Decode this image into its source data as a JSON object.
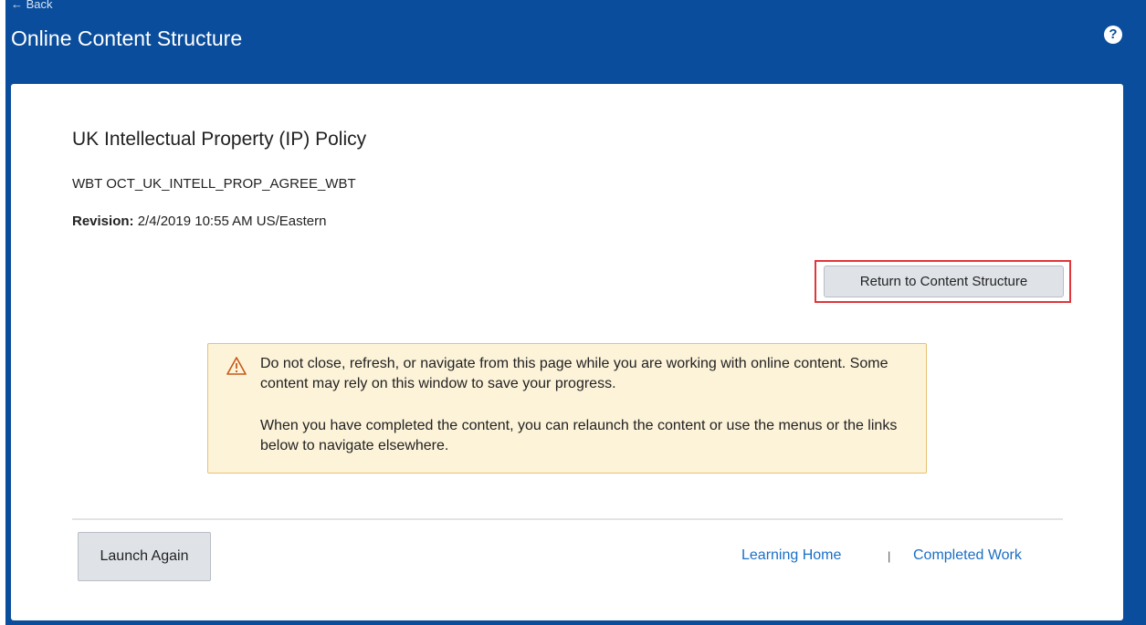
{
  "header": {
    "back_label": "← Back",
    "title": "Online Content Structure",
    "help_icon": "question-circle-icon"
  },
  "content": {
    "title": "UK Intellectual Property (IP) Policy",
    "id_line": "WBT OCT_UK_INTELL_PROP_AGREE_WBT",
    "revision_label": "Revision:",
    "revision_value": "2/4/2019 10:55 AM US/Eastern"
  },
  "actions": {
    "return_label": "Return to Content Structure",
    "launch_label": "Launch Again"
  },
  "warning": {
    "icon": "warning-triangle-icon",
    "text1": "Do not close, refresh, or navigate from this page while you are working with online content. Some content may rely on this window to save your progress.",
    "text2": "When you have completed the content, you can relaunch the content or use the menus or the links below to navigate elsewhere."
  },
  "footer": {
    "links": [
      "Learning Home",
      "Completed Work"
    ],
    "separator": "|"
  },
  "colors": {
    "header_bg": "#0a4d9c",
    "link": "#1a6fc7",
    "highlight": "#e0363a",
    "warning_bg": "#fdf3d9",
    "warning_border": "#e7c173"
  }
}
